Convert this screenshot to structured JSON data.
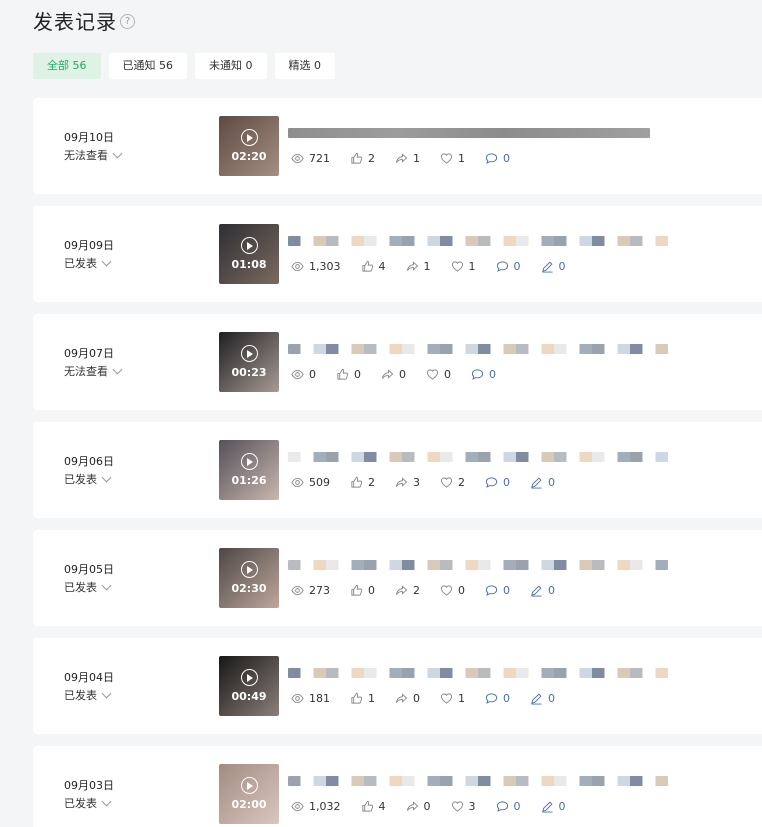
{
  "header": {
    "title": "发表记录",
    "help_icon": "?"
  },
  "filters": [
    {
      "label": "全部 56",
      "active": true
    },
    {
      "label": "已通知 56",
      "active": false
    },
    {
      "label": "未通知 0",
      "active": false
    },
    {
      "label": "精选 0",
      "active": false
    }
  ],
  "records": [
    {
      "date": "09月10日",
      "status": "无法查看",
      "duration": "02:20",
      "views": "721",
      "likes": "2",
      "shares": "1",
      "favorites": "1",
      "comments": "0",
      "show_edit": false,
      "edit": "",
      "thumb_colors": [
        "#5e4a41",
        "#a58f83"
      ]
    },
    {
      "date": "09月09日",
      "status": "已发表",
      "duration": "01:08",
      "views": "1,303",
      "likes": "4",
      "shares": "1",
      "favorites": "1",
      "comments": "0",
      "show_edit": true,
      "edit": "0",
      "thumb_colors": [
        "#2e2e33",
        "#7a6a5f"
      ]
    },
    {
      "date": "09月07日",
      "status": "无法查看",
      "duration": "00:23",
      "views": "0",
      "likes": "0",
      "shares": "0",
      "favorites": "0",
      "comments": "0",
      "show_edit": false,
      "edit": "",
      "thumb_colors": [
        "#1f1f22",
        "#a89b93"
      ]
    },
    {
      "date": "09月06日",
      "status": "已发表",
      "duration": "01:26",
      "views": "509",
      "likes": "2",
      "shares": "3",
      "favorites": "2",
      "comments": "0",
      "show_edit": true,
      "edit": "0",
      "thumb_colors": [
        "#56505a",
        "#c7b7ad"
      ]
    },
    {
      "date": "09月05日",
      "status": "已发表",
      "duration": "02:30",
      "views": "273",
      "likes": "0",
      "shares": "2",
      "favorites": "0",
      "comments": "0",
      "show_edit": true,
      "edit": "0",
      "thumb_colors": [
        "#4d4747",
        "#bfa69a"
      ]
    },
    {
      "date": "09月04日",
      "status": "已发表",
      "duration": "00:49",
      "views": "181",
      "likes": "1",
      "shares": "0",
      "favorites": "1",
      "comments": "0",
      "show_edit": true,
      "edit": "0",
      "thumb_colors": [
        "#171717",
        "#8c7f79"
      ]
    },
    {
      "date": "09月03日",
      "status": "已发表",
      "duration": "02:00",
      "views": "1,032",
      "likes": "4",
      "shares": "0",
      "favorites": "3",
      "comments": "0",
      "show_edit": true,
      "edit": "0",
      "thumb_colors": [
        "#a28c82",
        "#d9c6bf"
      ]
    }
  ],
  "colors": {
    "active_tab_bg": "#dff2e6",
    "active_tab_text": "#27a85f",
    "comment_blue": "#4a6fb5"
  }
}
